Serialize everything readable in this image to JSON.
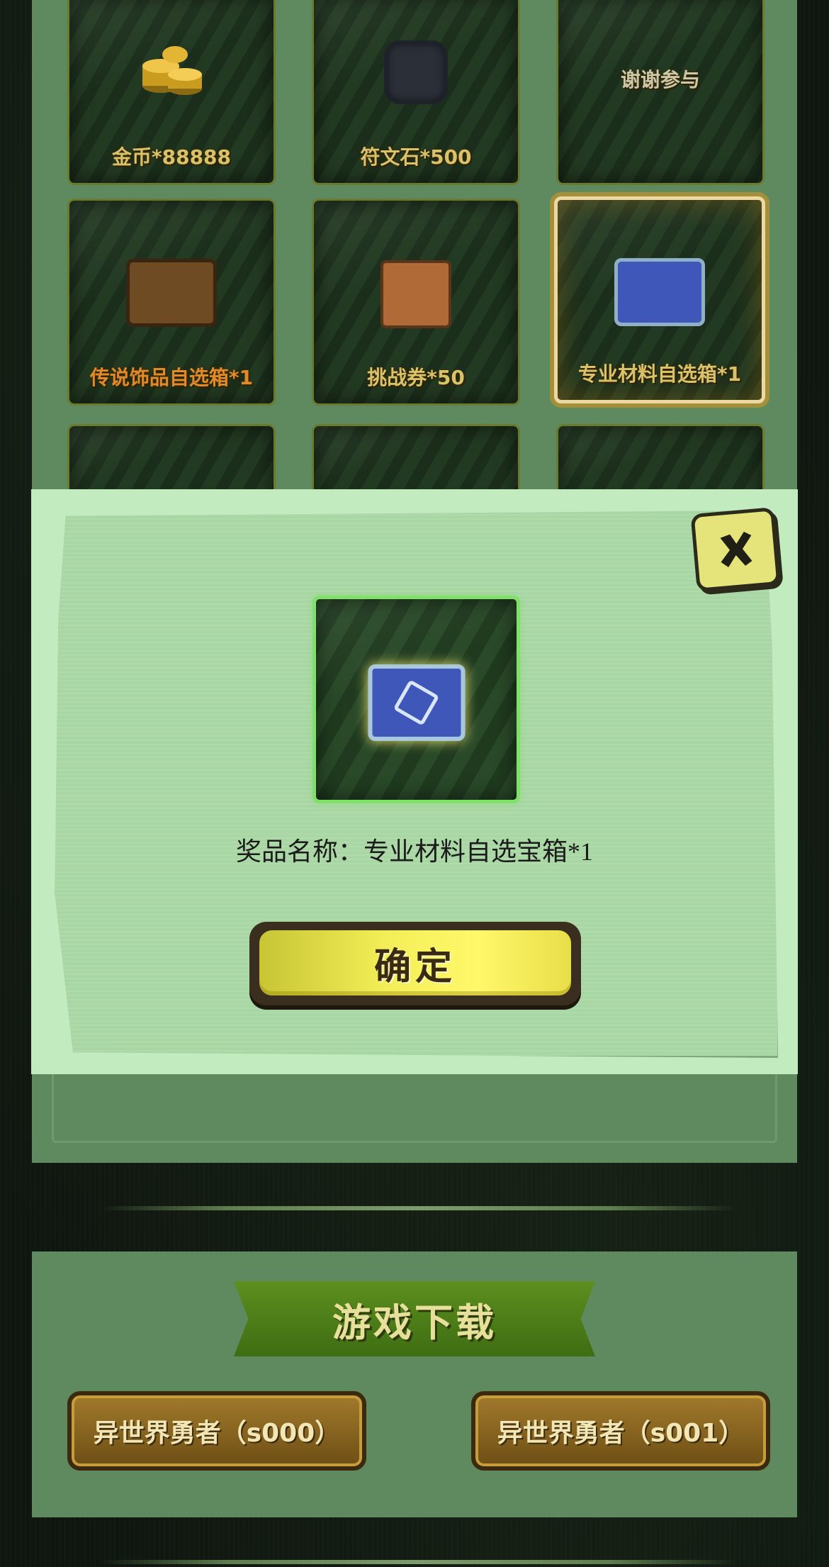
{
  "lottery": {
    "cells": [
      {
        "label": "金币*88888",
        "icon": "gold-coins-icon"
      },
      {
        "label": "符文石*500",
        "icon": "rune-stone-icon"
      },
      {
        "label": "谢谢参与",
        "icon": ""
      },
      {
        "label": "传说饰品自选箱*1",
        "icon": "legend-chest-icon"
      },
      {
        "label": "挑战券*50",
        "icon": "challenge-ticket-icon"
      },
      {
        "label": "专业材料自选箱*1",
        "icon": "blue-chest-icon"
      }
    ]
  },
  "modal": {
    "prize_label": "奖品名称：专业材料自选宝箱*1",
    "confirm_label": "确定",
    "close_icon": "close-icon"
  },
  "download": {
    "title": "游戏下载",
    "buttons": [
      {
        "label": "异世界勇者（s000）"
      },
      {
        "label": "异世界勇者（s001）"
      }
    ]
  },
  "colors": {
    "panel_green": "#5f8a5f",
    "modal_green": "#a9d7a4",
    "gold_text": "#d9c26a",
    "orange_text": "#e08a2a",
    "confirm_yellow": "#f2ee57"
  }
}
